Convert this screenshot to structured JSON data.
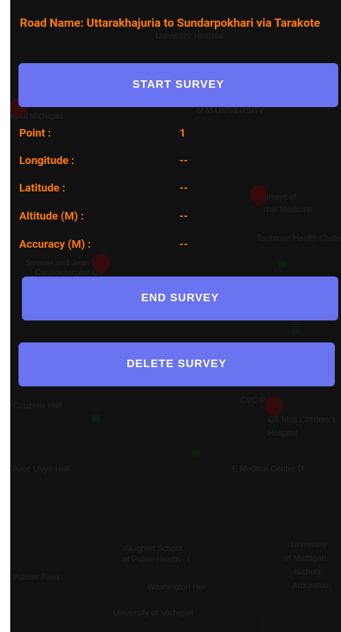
{
  "road": {
    "label": "Road Name: Uttarakhajuria to Sundarpokhari via Tarakote"
  },
  "buttons": {
    "start": "START SURVEY",
    "end": "END SURVEY",
    "delete": "DELETE SURVEY"
  },
  "fields": [
    {
      "label": "Point :",
      "value": "1"
    },
    {
      "label": "Longitude :",
      "value": "--"
    },
    {
      "label": "Latitude :",
      "value": "--"
    },
    {
      "label": "Altitude (M) :",
      "value": "--"
    },
    {
      "label": "Accuracy (M) :",
      "value": "--"
    }
  ],
  "map": {
    "labels": [
      "University Hospital",
      "ity of Michigan",
      "of M UNIVERSITY",
      "rtment of",
      "rnal Medicine",
      "Taubman Health Center",
      "Samuel and Jean Fr",
      "Cardiovascular C",
      "Couzens Hall",
      "CVC P",
      "CS Mott Children's",
      "Hospital",
      "Alice Lloyd Hall",
      "E Medical Center D",
      "Vaughan School",
      "of Public Health - I",
      "Palmer Field",
      "University",
      "of Michigan",
      "Nichols",
      "Arboretum",
      "University of Michigan",
      "Washington Hei"
    ]
  },
  "colors": {
    "accent_text": "#ff7a00",
    "button_bg": "#6a73f0",
    "background": "#1b1b1b"
  }
}
